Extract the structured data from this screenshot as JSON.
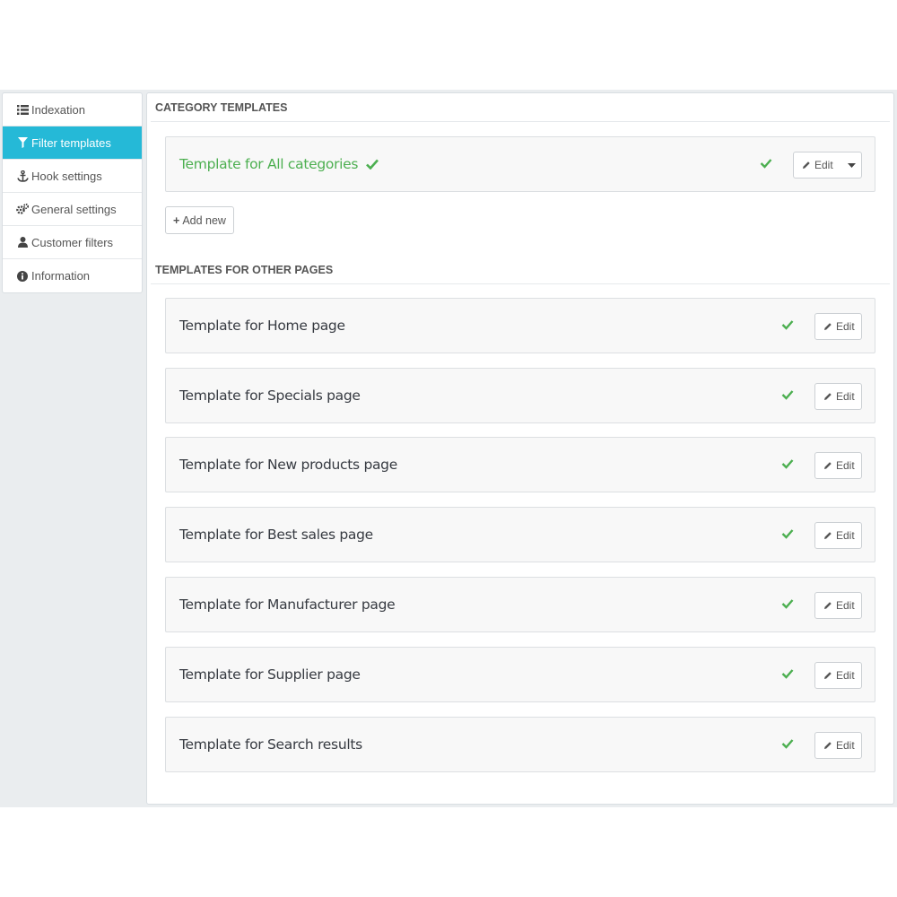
{
  "sidebar": {
    "items": [
      {
        "label": "Indexation",
        "icon": "list-icon",
        "active": false
      },
      {
        "label": "Filter templates",
        "icon": "filter-icon",
        "active": true
      },
      {
        "label": "Hook settings",
        "icon": "anchor-icon",
        "active": false
      },
      {
        "label": "General settings",
        "icon": "gears-icon",
        "active": false
      },
      {
        "label": "Customer filters",
        "icon": "user-icon",
        "active": false
      },
      {
        "label": "Information",
        "icon": "info-circle-icon",
        "active": false
      }
    ]
  },
  "category_section": {
    "title": "CATEGORY TEMPLATES",
    "template": {
      "name": "Template for All categories",
      "edit_label": "Edit"
    },
    "add_label": "Add new"
  },
  "other_section": {
    "title": "TEMPLATES FOR OTHER PAGES",
    "templates": [
      {
        "name": "Template for Home page",
        "edit_label": "Edit"
      },
      {
        "name": "Template for Specials page",
        "edit_label": "Edit"
      },
      {
        "name": "Template for New products page",
        "edit_label": "Edit"
      },
      {
        "name": "Template for Best sales page",
        "edit_label": "Edit"
      },
      {
        "name": "Template for Manufacturer page",
        "edit_label": "Edit"
      },
      {
        "name": "Template for Supplier page",
        "edit_label": "Edit"
      },
      {
        "name": "Template for Search results",
        "edit_label": "Edit"
      }
    ]
  },
  "colors": {
    "accent": "#25b9d7",
    "success": "#4caf50"
  }
}
